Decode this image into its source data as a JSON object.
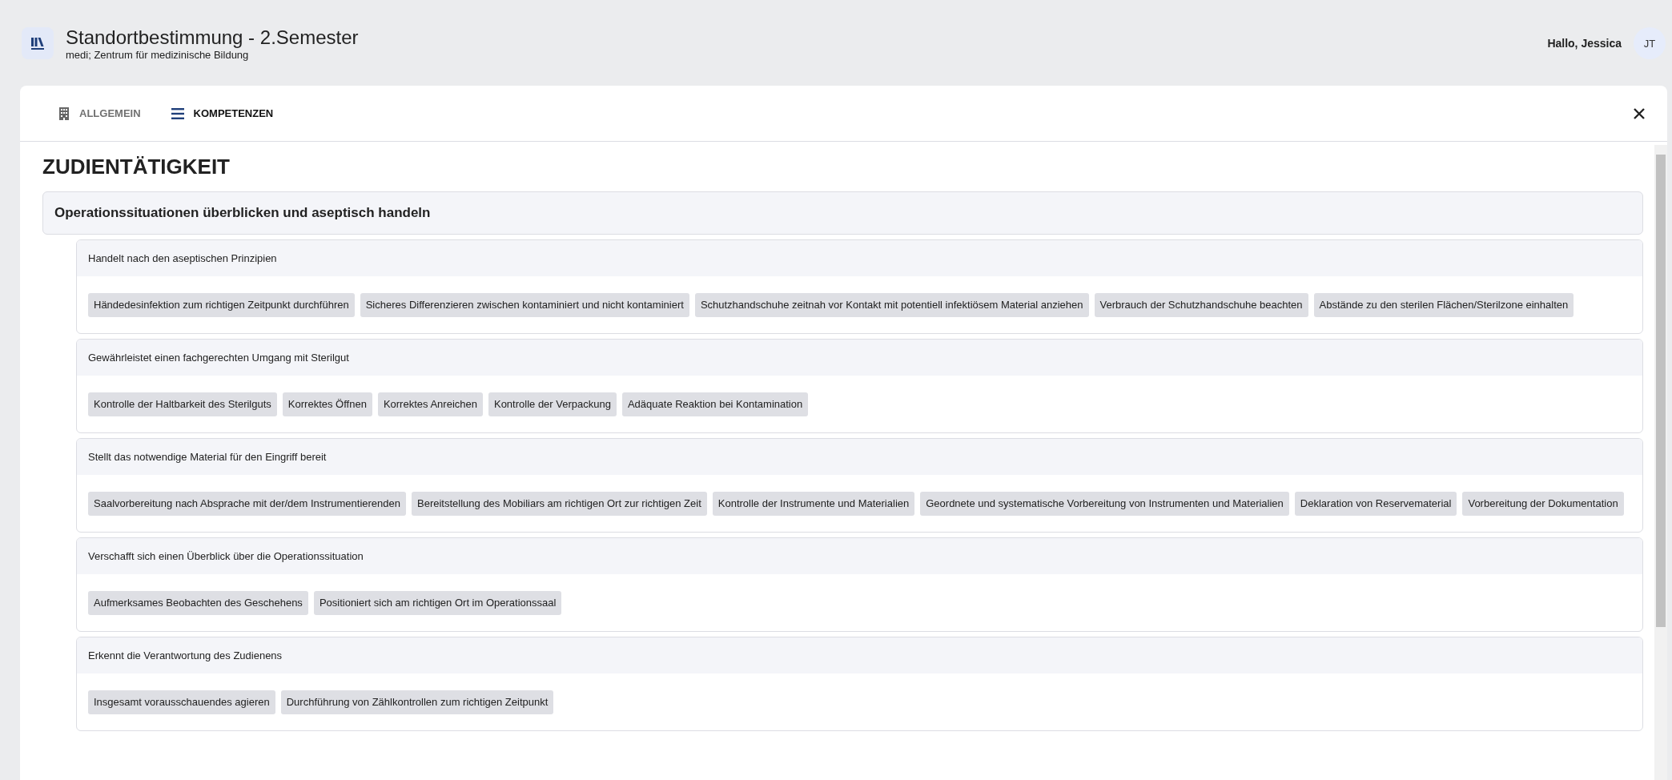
{
  "header": {
    "title": "Standortbestimmung - 2.Semester",
    "subtitle": "medi; Zentrum für medizinische Bildung",
    "greeting": "Hallo, Jessica",
    "avatar_initials": "JT"
  },
  "tabs": [
    {
      "label": "ALLGEMEIN",
      "selected": false
    },
    {
      "label": "KOMPETENZEN",
      "selected": true
    }
  ],
  "section": {
    "title": "ZUDIENTÄTIGKEIT",
    "group": {
      "title": "Operationssituationen überblicken und aseptisch handeln",
      "competences": [
        {
          "title": "Handelt nach den aseptischen Prinzipien",
          "items": [
            "Händedesinfektion zum richtigen Zeitpunkt durchführen",
            "Sicheres Differenzieren zwischen kontaminiert und nicht kontaminiert",
            "Schutzhandschuhe zeitnah vor Kontakt mit potentiell infektiösem Material anziehen",
            "Verbrauch der Schutzhandschuhe beachten",
            "Abstände zu den sterilen Flächen/Sterilzone einhalten"
          ]
        },
        {
          "title": "Gewährleistet einen fachgerechten Umgang mit Sterilgut",
          "items": [
            "Kontrolle der Haltbarkeit des Sterilguts",
            "Korrektes Öffnen",
            "Korrektes Anreichen",
            "Kontrolle der Verpackung",
            "Adäquate Reaktion bei Kontamination"
          ]
        },
        {
          "title": "Stellt das notwendige Material für den Eingriff bereit",
          "items": [
            "Saalvorbereitung nach Absprache mit der/dem Instrumentierenden",
            "Bereitstellung des Mobiliars am richtigen Ort zur richtigen Zeit",
            "Kontrolle der Instrumente und Materialien",
            "Geordnete und systematische Vorbereitung von Instrumenten und Materialien",
            "Deklaration von Reservematerial",
            "Vorbereitung der Dokumentation"
          ]
        },
        {
          "title": "Verschafft sich einen Überblick über die Operationssituation",
          "items": [
            "Aufmerksames Beobachten des Geschehens",
            "Positioniert sich am richtigen Ort im Operationssaal"
          ]
        },
        {
          "title": "Erkennt die Verantwortung des Zudienens",
          "items": [
            "Insgesamt vorausschauendes agieren",
            "Durchführung von Zählkontrollen zum richtigen Zeitpunkt"
          ]
        }
      ]
    }
  }
}
